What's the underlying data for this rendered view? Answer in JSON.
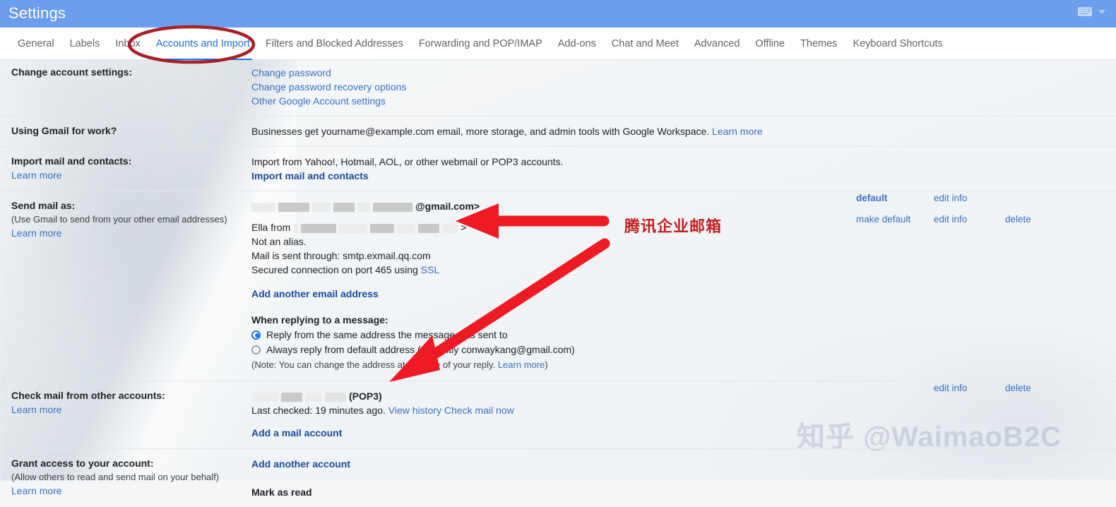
{
  "header": {
    "title": "Settings",
    "keyboard_icon": "keyboard-icon",
    "chevron_icon": "chevron-down-icon",
    "bar_color": "#6b9eed"
  },
  "tabs": [
    {
      "label": "General",
      "active": false
    },
    {
      "label": "Labels",
      "active": false
    },
    {
      "label": "Inbox",
      "active": false
    },
    {
      "label": "Accounts and Import",
      "active": true
    },
    {
      "label": "Filters and Blocked Addresses",
      "active": false
    },
    {
      "label": "Forwarding and POP/IMAP",
      "active": false
    },
    {
      "label": "Add-ons",
      "active": false
    },
    {
      "label": "Chat and Meet",
      "active": false
    },
    {
      "label": "Advanced",
      "active": false
    },
    {
      "label": "Offline",
      "active": false
    },
    {
      "label": "Themes",
      "active": false
    },
    {
      "label": "Keyboard Shortcuts",
      "active": false
    }
  ],
  "rows": {
    "change_account": {
      "label": "Change account settings:",
      "links": [
        "Change password",
        "Change password recovery options",
        "Other Google Account settings"
      ]
    },
    "gmail_for_work": {
      "label": "Using Gmail for work?",
      "text": "Businesses get yourname@example.com email, more storage, and admin tools with Google Workspace.",
      "link": "Learn more"
    },
    "import_mail": {
      "label": "Import mail and contacts:",
      "label_link": "Learn more",
      "text": "Import from Yahoo!, Hotmail, AOL, or other webmail or POP3 accounts.",
      "action_link": "Import mail and contacts"
    },
    "send_mail_as": {
      "label": "Send mail as:",
      "sub": "(Use Gmail to send from your other email addresses)",
      "label_link": "Learn more",
      "primary_address_suffix": "@gmail.com>",
      "alias_prefix": "Ella from",
      "alias_suffix": ">",
      "alias_note": "Not an alias.",
      "alias_smtp": "Mail is sent through: smtp.exmail.qq.com",
      "alias_secure_prefix": "Secured connection on port 465 using ",
      "alias_secure_link": "SSL",
      "add_link": "Add another email address",
      "actions_primary": [
        "default",
        "edit info"
      ],
      "actions_alias": [
        "make default",
        "edit info",
        "delete"
      ],
      "reply_heading": "When replying to a message:",
      "reply_option_1": "Reply from the same address the message was sent to",
      "reply_option_2": "Always reply from default address (currently conwaykang@gmail.com)",
      "reply_selected": 1,
      "reply_note_prefix": "(Note: You can change the address at the time of your reply. ",
      "reply_note_link": "Learn more",
      "reply_note_suffix": ")"
    },
    "check_mail": {
      "label": "Check mail from other accounts:",
      "label_link": "Learn more",
      "account_protocol": "(POP3)",
      "status": "Last checked: 19 minutes ago.",
      "link_view_history": "View history",
      "link_check_now": "Check mail now",
      "add_link": "Add a mail account",
      "actions": [
        "edit info",
        "delete"
      ]
    },
    "grant_access": {
      "label": "Grant access to your account:",
      "sub": "(Allow others to read and send mail on your behalf)",
      "label_link": "Learn more",
      "add_link": "Add another account",
      "mark_as_read": "Mark as read"
    }
  },
  "annotations": {
    "chinese_note": "腾讯企业邮箱",
    "note_color": "#c02020",
    "arrow_color": "#ee1b24",
    "ellipse_color": "#a82028",
    "watermark": "知乎 @WaimaoB2C"
  }
}
